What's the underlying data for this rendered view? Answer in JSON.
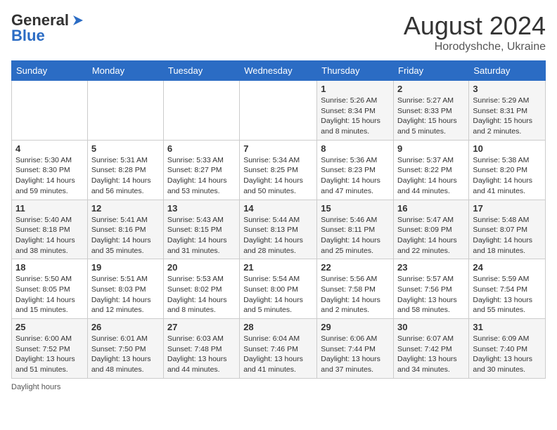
{
  "header": {
    "logo_line1": "General",
    "logo_line2": "Blue",
    "month_title": "August 2024",
    "location": "Horodyshche, Ukraine"
  },
  "weekdays": [
    "Sunday",
    "Monday",
    "Tuesday",
    "Wednesday",
    "Thursday",
    "Friday",
    "Saturday"
  ],
  "weeks": [
    [
      {
        "day": "",
        "info": ""
      },
      {
        "day": "",
        "info": ""
      },
      {
        "day": "",
        "info": ""
      },
      {
        "day": "",
        "info": ""
      },
      {
        "day": "1",
        "info": "Sunrise: 5:26 AM\nSunset: 8:34 PM\nDaylight: 15 hours\nand 8 minutes."
      },
      {
        "day": "2",
        "info": "Sunrise: 5:27 AM\nSunset: 8:33 PM\nDaylight: 15 hours\nand 5 minutes."
      },
      {
        "day": "3",
        "info": "Sunrise: 5:29 AM\nSunset: 8:31 PM\nDaylight: 15 hours\nand 2 minutes."
      }
    ],
    [
      {
        "day": "4",
        "info": "Sunrise: 5:30 AM\nSunset: 8:30 PM\nDaylight: 14 hours\nand 59 minutes."
      },
      {
        "day": "5",
        "info": "Sunrise: 5:31 AM\nSunset: 8:28 PM\nDaylight: 14 hours\nand 56 minutes."
      },
      {
        "day": "6",
        "info": "Sunrise: 5:33 AM\nSunset: 8:27 PM\nDaylight: 14 hours\nand 53 minutes."
      },
      {
        "day": "7",
        "info": "Sunrise: 5:34 AM\nSunset: 8:25 PM\nDaylight: 14 hours\nand 50 minutes."
      },
      {
        "day": "8",
        "info": "Sunrise: 5:36 AM\nSunset: 8:23 PM\nDaylight: 14 hours\nand 47 minutes."
      },
      {
        "day": "9",
        "info": "Sunrise: 5:37 AM\nSunset: 8:22 PM\nDaylight: 14 hours\nand 44 minutes."
      },
      {
        "day": "10",
        "info": "Sunrise: 5:38 AM\nSunset: 8:20 PM\nDaylight: 14 hours\nand 41 minutes."
      }
    ],
    [
      {
        "day": "11",
        "info": "Sunrise: 5:40 AM\nSunset: 8:18 PM\nDaylight: 14 hours\nand 38 minutes."
      },
      {
        "day": "12",
        "info": "Sunrise: 5:41 AM\nSunset: 8:16 PM\nDaylight: 14 hours\nand 35 minutes."
      },
      {
        "day": "13",
        "info": "Sunrise: 5:43 AM\nSunset: 8:15 PM\nDaylight: 14 hours\nand 31 minutes."
      },
      {
        "day": "14",
        "info": "Sunrise: 5:44 AM\nSunset: 8:13 PM\nDaylight: 14 hours\nand 28 minutes."
      },
      {
        "day": "15",
        "info": "Sunrise: 5:46 AM\nSunset: 8:11 PM\nDaylight: 14 hours\nand 25 minutes."
      },
      {
        "day": "16",
        "info": "Sunrise: 5:47 AM\nSunset: 8:09 PM\nDaylight: 14 hours\nand 22 minutes."
      },
      {
        "day": "17",
        "info": "Sunrise: 5:48 AM\nSunset: 8:07 PM\nDaylight: 14 hours\nand 18 minutes."
      }
    ],
    [
      {
        "day": "18",
        "info": "Sunrise: 5:50 AM\nSunset: 8:05 PM\nDaylight: 14 hours\nand 15 minutes."
      },
      {
        "day": "19",
        "info": "Sunrise: 5:51 AM\nSunset: 8:03 PM\nDaylight: 14 hours\nand 12 minutes."
      },
      {
        "day": "20",
        "info": "Sunrise: 5:53 AM\nSunset: 8:02 PM\nDaylight: 14 hours\nand 8 minutes."
      },
      {
        "day": "21",
        "info": "Sunrise: 5:54 AM\nSunset: 8:00 PM\nDaylight: 14 hours\nand 5 minutes."
      },
      {
        "day": "22",
        "info": "Sunrise: 5:56 AM\nSunset: 7:58 PM\nDaylight: 14 hours\nand 2 minutes."
      },
      {
        "day": "23",
        "info": "Sunrise: 5:57 AM\nSunset: 7:56 PM\nDaylight: 13 hours\nand 58 minutes."
      },
      {
        "day": "24",
        "info": "Sunrise: 5:59 AM\nSunset: 7:54 PM\nDaylight: 13 hours\nand 55 minutes."
      }
    ],
    [
      {
        "day": "25",
        "info": "Sunrise: 6:00 AM\nSunset: 7:52 PM\nDaylight: 13 hours\nand 51 minutes."
      },
      {
        "day": "26",
        "info": "Sunrise: 6:01 AM\nSunset: 7:50 PM\nDaylight: 13 hours\nand 48 minutes."
      },
      {
        "day": "27",
        "info": "Sunrise: 6:03 AM\nSunset: 7:48 PM\nDaylight: 13 hours\nand 44 minutes."
      },
      {
        "day": "28",
        "info": "Sunrise: 6:04 AM\nSunset: 7:46 PM\nDaylight: 13 hours\nand 41 minutes."
      },
      {
        "day": "29",
        "info": "Sunrise: 6:06 AM\nSunset: 7:44 PM\nDaylight: 13 hours\nand 37 minutes."
      },
      {
        "day": "30",
        "info": "Sunrise: 6:07 AM\nSunset: 7:42 PM\nDaylight: 13 hours\nand 34 minutes."
      },
      {
        "day": "31",
        "info": "Sunrise: 6:09 AM\nSunset: 7:40 PM\nDaylight: 13 hours\nand 30 minutes."
      }
    ]
  ],
  "footer": {
    "note": "Daylight hours"
  }
}
